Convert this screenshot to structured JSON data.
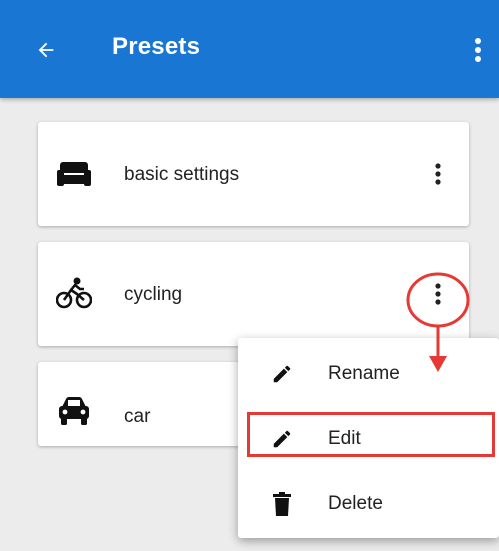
{
  "appbar": {
    "title": "Presets",
    "back_icon": "arrow-left-icon",
    "menu_icon": "more-vertical-icon",
    "color": "#1976d2"
  },
  "presets": [
    {
      "label": "basic settings",
      "icon": "sofa-icon"
    },
    {
      "label": "cycling",
      "icon": "bicycle-icon"
    },
    {
      "label": "car",
      "icon": "car-icon"
    }
  ],
  "context_menu": {
    "items": [
      {
        "label": "Rename",
        "icon": "pencil-icon"
      },
      {
        "label": "Edit",
        "icon": "pencil-icon",
        "highlighted": true
      },
      {
        "label": "Delete",
        "icon": "trash-icon"
      }
    ]
  },
  "annotation": {
    "color": "#e53935"
  }
}
